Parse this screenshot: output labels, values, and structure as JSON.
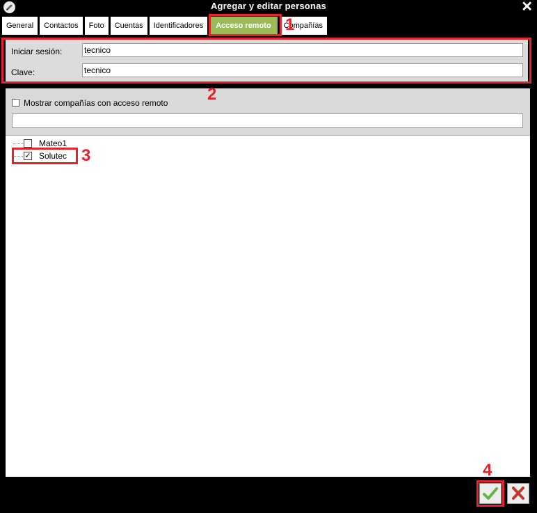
{
  "window": {
    "title": "Agregar y editar personas",
    "close_glyph": "✕",
    "icon": "pencil-icon"
  },
  "tabs": [
    {
      "label": "General",
      "active": false
    },
    {
      "label": "Contactos",
      "active": false
    },
    {
      "label": "Foto",
      "active": false
    },
    {
      "label": "Cuentas",
      "active": false
    },
    {
      "label": "Identificadores",
      "active": false
    },
    {
      "label": "Acceso remoto",
      "active": true
    },
    {
      "label": "Compañías",
      "active": false
    }
  ],
  "login": {
    "user_label": "Iniciar sesión:",
    "user_value": "tecnico",
    "password_label": "Clave:",
    "password_value": "tecnico"
  },
  "remote": {
    "show_companies_label": "Mostrar compañías con acceso remoto",
    "show_companies_checked": false,
    "filter_value": "",
    "companies": [
      {
        "name": "Mateo1",
        "checked": false
      },
      {
        "name": "Solutec",
        "checked": true
      }
    ]
  },
  "buttons": {
    "ok_icon": "checkmark-icon",
    "cancel_icon": "x-icon"
  },
  "annotations": [
    "1",
    "2",
    "3",
    "4"
  ],
  "colors": {
    "active_tab": "#9bbb59",
    "annotation_red": "#e8222b",
    "ok_green": "#6ab04c",
    "cancel_red": "#c0392b"
  }
}
